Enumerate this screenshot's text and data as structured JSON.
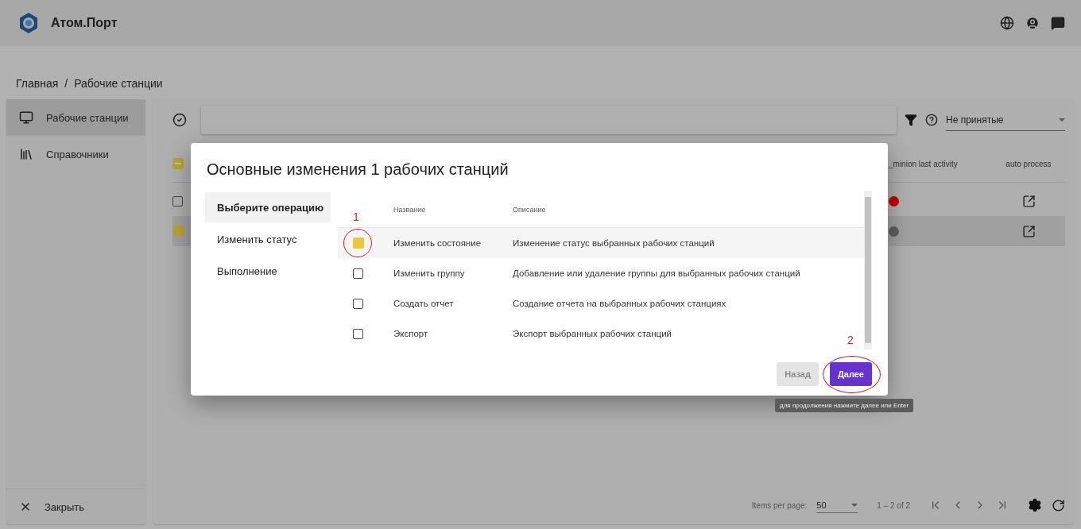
{
  "app": {
    "title": "Атом.Порт"
  },
  "breadcrumb": {
    "items": [
      "Главная",
      "Рабочие станции"
    ],
    "separator": "/"
  },
  "sidebar": {
    "items": [
      {
        "label": "Рабочие станции",
        "selected": true,
        "kind": "monitor"
      },
      {
        "label": "Справочники",
        "selected": false,
        "kind": "book"
      }
    ],
    "close": "Закрыть"
  },
  "toolbar": {
    "status_select": {
      "value": "Не принятые"
    }
  },
  "table": {
    "header_checkbox": {
      "indeterminate": true
    },
    "columns": [
      "_minion last activity",
      "auto process"
    ],
    "rows": [
      {
        "checked": false,
        "selected": false,
        "color": "#c40000"
      },
      {
        "checked": true,
        "selected": true,
        "color": "#5e5e5e"
      }
    ]
  },
  "paginator": {
    "label": "Items per page:",
    "page_size": "50",
    "range": "1 – 2 of 2"
  },
  "dialog": {
    "title": "Основные изменения 1 рабочих станций",
    "steps": [
      {
        "label": "Выберите операцию",
        "selected": true
      },
      {
        "label": "Изменить статус",
        "selected": false
      },
      {
        "label": "Выполнение",
        "selected": false
      }
    ],
    "columns": [
      "Название",
      "Описание"
    ],
    "operations": [
      {
        "name": "Изменить состояние",
        "description": "Изменение статус выбранных рабочих станций",
        "checked": true,
        "annotation": "1"
      },
      {
        "name": "Изменить группу",
        "description": "Добавление или удаление группы для выбранных рабочих станций",
        "checked": false
      },
      {
        "name": "Создать отчет",
        "description": "Создание отчета на выбранных рабочих станциях",
        "checked": false
      },
      {
        "name": "Экспорт",
        "description": "Экспорт выбранных рабочих станций",
        "checked": false
      }
    ],
    "buttons": [
      {
        "label": "Назад",
        "disabled": true
      },
      {
        "label": "Далее",
        "disabled": false,
        "annotation": "2"
      }
    ],
    "tooltip": "для продолжения нажмите далее или Enter"
  }
}
